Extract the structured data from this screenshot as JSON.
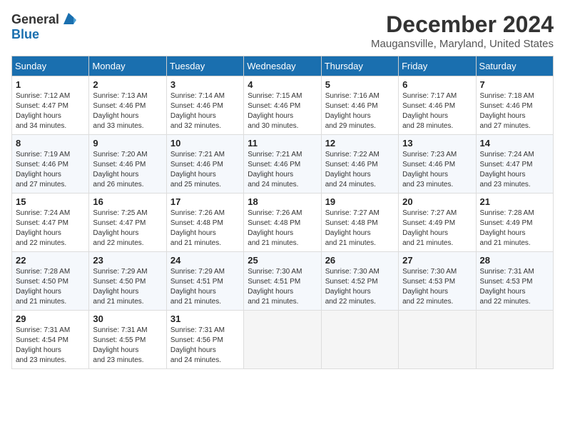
{
  "header": {
    "logo_general": "General",
    "logo_blue": "Blue",
    "month_title": "December 2024",
    "location": "Maugansville, Maryland, United States"
  },
  "weekdays": [
    "Sunday",
    "Monday",
    "Tuesday",
    "Wednesday",
    "Thursday",
    "Friday",
    "Saturday"
  ],
  "weeks": [
    [
      {
        "day": "1",
        "sunrise": "Sunrise: 7:12 AM",
        "sunset": "Sunset: 4:47 PM",
        "daylight": "Daylight: 9 hours and 34 minutes."
      },
      {
        "day": "2",
        "sunrise": "Sunrise: 7:13 AM",
        "sunset": "Sunset: 4:46 PM",
        "daylight": "Daylight: 9 hours and 33 minutes."
      },
      {
        "day": "3",
        "sunrise": "Sunrise: 7:14 AM",
        "sunset": "Sunset: 4:46 PM",
        "daylight": "Daylight: 9 hours and 32 minutes."
      },
      {
        "day": "4",
        "sunrise": "Sunrise: 7:15 AM",
        "sunset": "Sunset: 4:46 PM",
        "daylight": "Daylight: 9 hours and 30 minutes."
      },
      {
        "day": "5",
        "sunrise": "Sunrise: 7:16 AM",
        "sunset": "Sunset: 4:46 PM",
        "daylight": "Daylight: 9 hours and 29 minutes."
      },
      {
        "day": "6",
        "sunrise": "Sunrise: 7:17 AM",
        "sunset": "Sunset: 4:46 PM",
        "daylight": "Daylight: 9 hours and 28 minutes."
      },
      {
        "day": "7",
        "sunrise": "Sunrise: 7:18 AM",
        "sunset": "Sunset: 4:46 PM",
        "daylight": "Daylight: 9 hours and 27 minutes."
      }
    ],
    [
      {
        "day": "8",
        "sunrise": "Sunrise: 7:19 AM",
        "sunset": "Sunset: 4:46 PM",
        "daylight": "Daylight: 9 hours and 27 minutes."
      },
      {
        "day": "9",
        "sunrise": "Sunrise: 7:20 AM",
        "sunset": "Sunset: 4:46 PM",
        "daylight": "Daylight: 9 hours and 26 minutes."
      },
      {
        "day": "10",
        "sunrise": "Sunrise: 7:21 AM",
        "sunset": "Sunset: 4:46 PM",
        "daylight": "Daylight: 9 hours and 25 minutes."
      },
      {
        "day": "11",
        "sunrise": "Sunrise: 7:21 AM",
        "sunset": "Sunset: 4:46 PM",
        "daylight": "Daylight: 9 hours and 24 minutes."
      },
      {
        "day": "12",
        "sunrise": "Sunrise: 7:22 AM",
        "sunset": "Sunset: 4:46 PM",
        "daylight": "Daylight: 9 hours and 24 minutes."
      },
      {
        "day": "13",
        "sunrise": "Sunrise: 7:23 AM",
        "sunset": "Sunset: 4:46 PM",
        "daylight": "Daylight: 9 hours and 23 minutes."
      },
      {
        "day": "14",
        "sunrise": "Sunrise: 7:24 AM",
        "sunset": "Sunset: 4:47 PM",
        "daylight": "Daylight: 9 hours and 23 minutes."
      }
    ],
    [
      {
        "day": "15",
        "sunrise": "Sunrise: 7:24 AM",
        "sunset": "Sunset: 4:47 PM",
        "daylight": "Daylight: 9 hours and 22 minutes."
      },
      {
        "day": "16",
        "sunrise": "Sunrise: 7:25 AM",
        "sunset": "Sunset: 4:47 PM",
        "daylight": "Daylight: 9 hours and 22 minutes."
      },
      {
        "day": "17",
        "sunrise": "Sunrise: 7:26 AM",
        "sunset": "Sunset: 4:48 PM",
        "daylight": "Daylight: 9 hours and 21 minutes."
      },
      {
        "day": "18",
        "sunrise": "Sunrise: 7:26 AM",
        "sunset": "Sunset: 4:48 PM",
        "daylight": "Daylight: 9 hours and 21 minutes."
      },
      {
        "day": "19",
        "sunrise": "Sunrise: 7:27 AM",
        "sunset": "Sunset: 4:48 PM",
        "daylight": "Daylight: 9 hours and 21 minutes."
      },
      {
        "day": "20",
        "sunrise": "Sunrise: 7:27 AM",
        "sunset": "Sunset: 4:49 PM",
        "daylight": "Daylight: 9 hours and 21 minutes."
      },
      {
        "day": "21",
        "sunrise": "Sunrise: 7:28 AM",
        "sunset": "Sunset: 4:49 PM",
        "daylight": "Daylight: 9 hours and 21 minutes."
      }
    ],
    [
      {
        "day": "22",
        "sunrise": "Sunrise: 7:28 AM",
        "sunset": "Sunset: 4:50 PM",
        "daylight": "Daylight: 9 hours and 21 minutes."
      },
      {
        "day": "23",
        "sunrise": "Sunrise: 7:29 AM",
        "sunset": "Sunset: 4:50 PM",
        "daylight": "Daylight: 9 hours and 21 minutes."
      },
      {
        "day": "24",
        "sunrise": "Sunrise: 7:29 AM",
        "sunset": "Sunset: 4:51 PM",
        "daylight": "Daylight: 9 hours and 21 minutes."
      },
      {
        "day": "25",
        "sunrise": "Sunrise: 7:30 AM",
        "sunset": "Sunset: 4:51 PM",
        "daylight": "Daylight: 9 hours and 21 minutes."
      },
      {
        "day": "26",
        "sunrise": "Sunrise: 7:30 AM",
        "sunset": "Sunset: 4:52 PM",
        "daylight": "Daylight: 9 hours and 22 minutes."
      },
      {
        "day": "27",
        "sunrise": "Sunrise: 7:30 AM",
        "sunset": "Sunset: 4:53 PM",
        "daylight": "Daylight: 9 hours and 22 minutes."
      },
      {
        "day": "28",
        "sunrise": "Sunrise: 7:31 AM",
        "sunset": "Sunset: 4:53 PM",
        "daylight": "Daylight: 9 hours and 22 minutes."
      }
    ],
    [
      {
        "day": "29",
        "sunrise": "Sunrise: 7:31 AM",
        "sunset": "Sunset: 4:54 PM",
        "daylight": "Daylight: 9 hours and 23 minutes."
      },
      {
        "day": "30",
        "sunrise": "Sunrise: 7:31 AM",
        "sunset": "Sunset: 4:55 PM",
        "daylight": "Daylight: 9 hours and 23 minutes."
      },
      {
        "day": "31",
        "sunrise": "Sunrise: 7:31 AM",
        "sunset": "Sunset: 4:56 PM",
        "daylight": "Daylight: 9 hours and 24 minutes."
      },
      null,
      null,
      null,
      null
    ]
  ]
}
